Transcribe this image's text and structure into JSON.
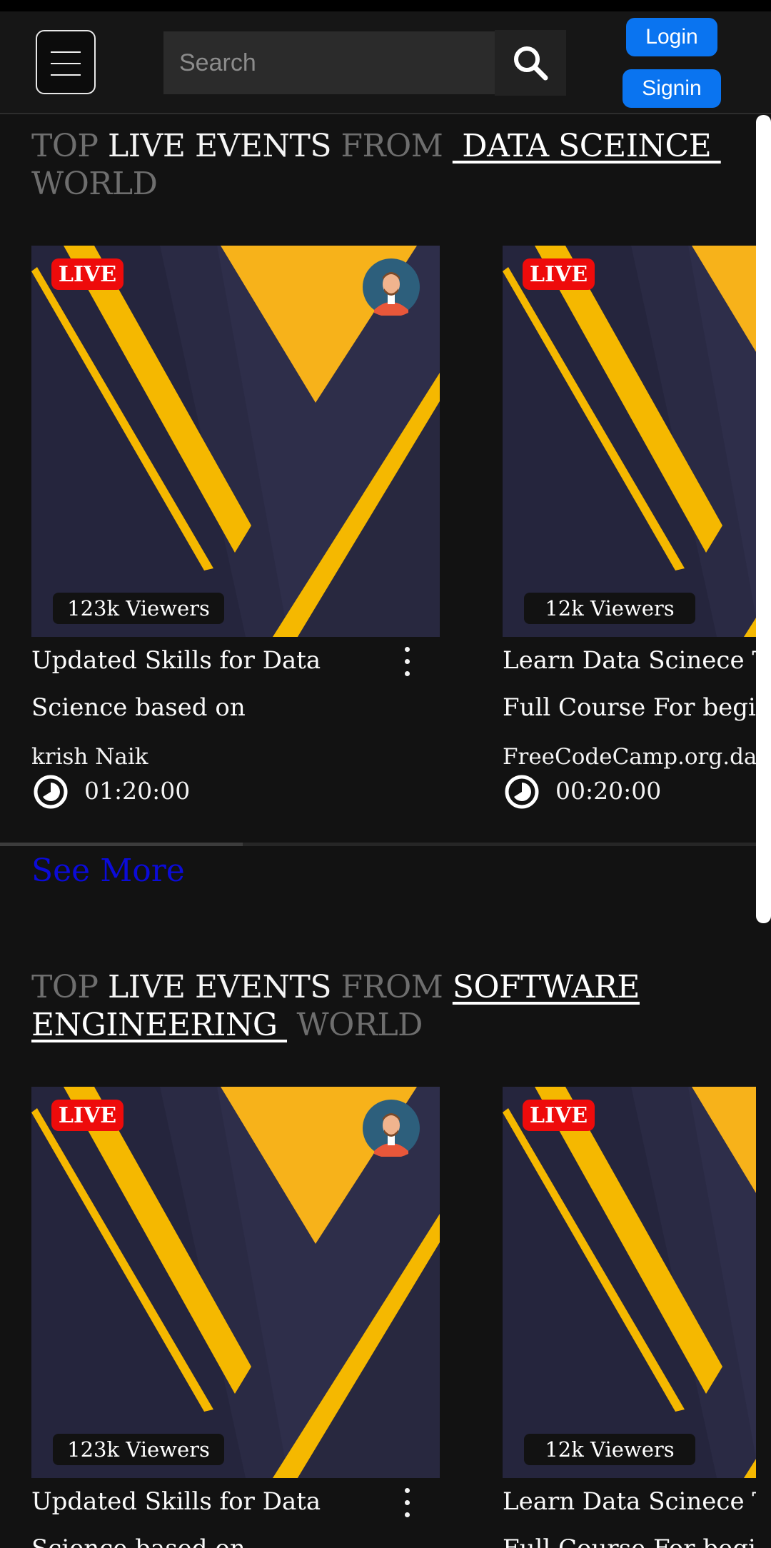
{
  "navbar": {
    "search_placeholder": "Search",
    "login_label": "Login",
    "signin_label": "Signin"
  },
  "colors": {
    "background": "#121212",
    "accent_button": "#0a74f0",
    "live_badge": "#ee0b0b",
    "see_more_link": "#0b0bd9",
    "thumbnail_yellow": "#f5b800",
    "thumbnail_navy": "#2a2a44"
  },
  "icons": {
    "menu": "hamburger-icon",
    "search": "magnifier-icon",
    "avatar": "presenter-avatar-icon",
    "more": "vertical-ellipsis-icon",
    "duration": "clock-icon"
  },
  "sections": [
    {
      "title_top": "TOP",
      "title_live_events": "LIVE EVENTS",
      "title_from": "FROM",
      "title_category": " DATA SCEINCE ",
      "title_world": "WORLD",
      "see_more_label": "See More",
      "cards": [
        {
          "live_label": "LIVE",
          "viewers": "123k Viewers",
          "title_line1": "Updated Skills for Data",
          "title_line2": "Science based on",
          "channel": "krish Naik",
          "duration": "01:20:00"
        },
        {
          "live_label": "LIVE",
          "viewers": "12k Viewers",
          "title_line1": "Learn Data Scinece Tu",
          "title_line2": "Full Course For begin",
          "channel": "FreeCodeCamp.org.datal",
          "duration": "00:20:00"
        }
      ]
    },
    {
      "title_top": "TOP",
      "title_live_events": "LIVE EVENTS",
      "title_from": "FROM",
      "title_category_line1": "SOFTWARE",
      "title_category_line2": "ENGINEERING ",
      "title_world": "WORLD",
      "cards": [
        {
          "live_label": "LIVE",
          "viewers": "123k Viewers",
          "title_line1": "Updated Skills for Data",
          "title_line2": "Science based on"
        },
        {
          "live_label": "LIVE",
          "viewers": "12k Viewers",
          "title_line1": "Learn Data Scinece Tu",
          "title_line2": "Full Course For begin"
        }
      ]
    }
  ]
}
